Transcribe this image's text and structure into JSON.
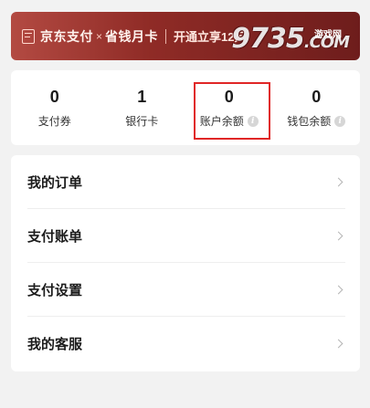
{
  "banner": {
    "brand_jd": "京东支付",
    "times": "×",
    "brand_card": "省钱月卡",
    "cta": "开通立享12元",
    "watermark": "9735",
    "watermark_sub": "游戏网",
    "watermark_domain": ".COM"
  },
  "stats": [
    {
      "value": "0",
      "label": "支付券",
      "info": false
    },
    {
      "value": "1",
      "label": "银行卡",
      "info": false
    },
    {
      "value": "0",
      "label": "账户余额",
      "info": true
    },
    {
      "value": "0",
      "label": "钱包余额",
      "info": true
    }
  ],
  "info_glyph": "i",
  "menu": [
    {
      "title": "我的订单"
    },
    {
      "title": "支付账单"
    },
    {
      "title": "支付设置"
    },
    {
      "title": "我的客服"
    }
  ],
  "colors": {
    "highlight": "#e02626",
    "banner": "#8f2b26"
  }
}
